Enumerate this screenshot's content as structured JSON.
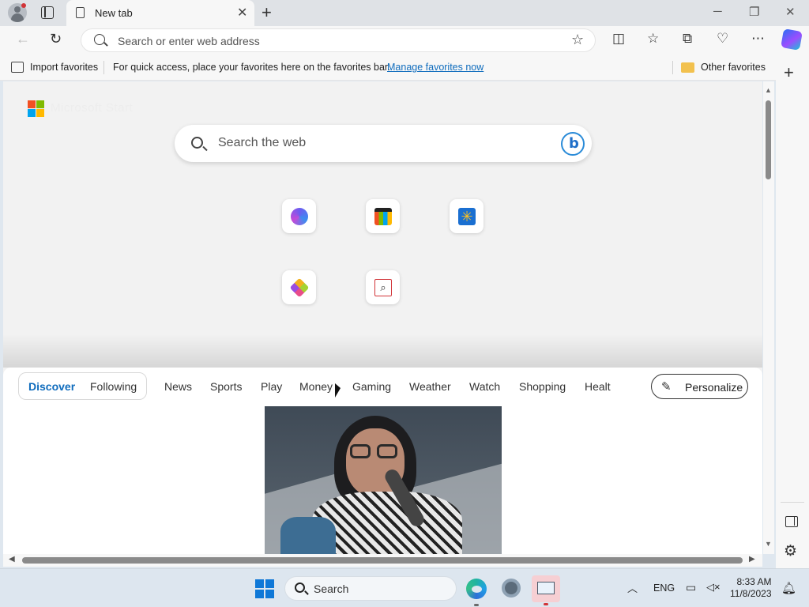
{
  "tab": {
    "title": "New tab"
  },
  "address_bar": {
    "placeholder": "Search or enter web address"
  },
  "favorites_bar": {
    "import_label": "Import favorites",
    "hint": "For quick access, place your favorites here on the favorites bar.",
    "manage_link": "Manage favorites now",
    "other_favorites": "Other favorites"
  },
  "newtab": {
    "brand": "Microsoft Start",
    "search_placeholder": "Search the web",
    "tiles": [
      {
        "icon": "microsoft-365-icon",
        "label": ""
      },
      {
        "icon": "microsoft-store-icon",
        "label": ""
      },
      {
        "icon": "walmart-icon",
        "label": ""
      },
      {
        "icon": "games-icon",
        "label": ""
      },
      {
        "icon": "search-quick-link-icon",
        "label": ""
      }
    ]
  },
  "feed": {
    "tabs": [
      "Discover",
      "Following"
    ],
    "categories": [
      "News",
      "Sports",
      "Play",
      "Money",
      "Gaming",
      "Weather",
      "Watch",
      "Shopping",
      "Healt"
    ],
    "personalize": "Personalize",
    "active_tab": "Discover"
  },
  "taskbar": {
    "search_label": "Search",
    "lang": "ENG",
    "time": "8:33 AM",
    "date": "11/8/2023"
  },
  "colors": {
    "accent": "#0f6cbd",
    "taskbar_bg": "#dde6ef"
  }
}
